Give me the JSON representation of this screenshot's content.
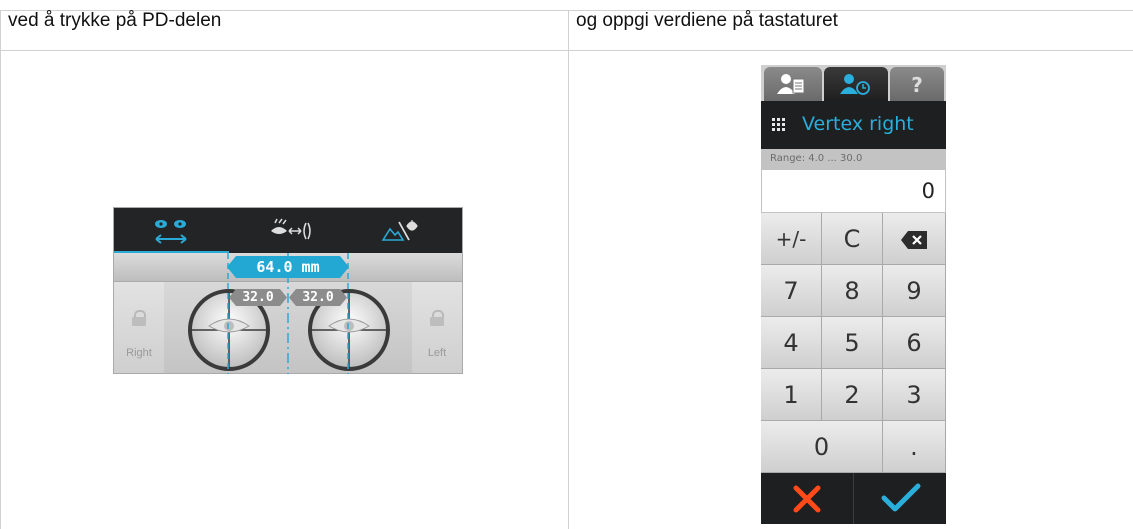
{
  "columns": {
    "left_header": "ved å trykke på PD-delen",
    "right_header": "og oppgi verdiene på tastaturet"
  },
  "pd_panel": {
    "total_pd": "64.0 mm",
    "right_pd": "32.0",
    "left_pd": "32.0",
    "right_label": "Right",
    "left_label": "Left",
    "top_icons": [
      "eyes-pd-icon",
      "vertex-distance-icon",
      "near-far-icon"
    ],
    "accent_color": "#23a7d3"
  },
  "keypad": {
    "title": "Vertex right",
    "range": "Range: 4.0 ... 30.0",
    "value": "0",
    "keys": {
      "sign": "+/-",
      "clear": "C",
      "k7": "7",
      "k8": "8",
      "k9": "9",
      "k4": "4",
      "k5": "5",
      "k6": "6",
      "k1": "1",
      "k2": "2",
      "k3": "3",
      "k0": "0",
      "dot": "."
    },
    "tab_icons": [
      "patient-record-icon",
      "patient-history-icon",
      "help-icon"
    ],
    "cancel_color": "#ff4a1a",
    "confirm_color": "#2aaedb"
  }
}
